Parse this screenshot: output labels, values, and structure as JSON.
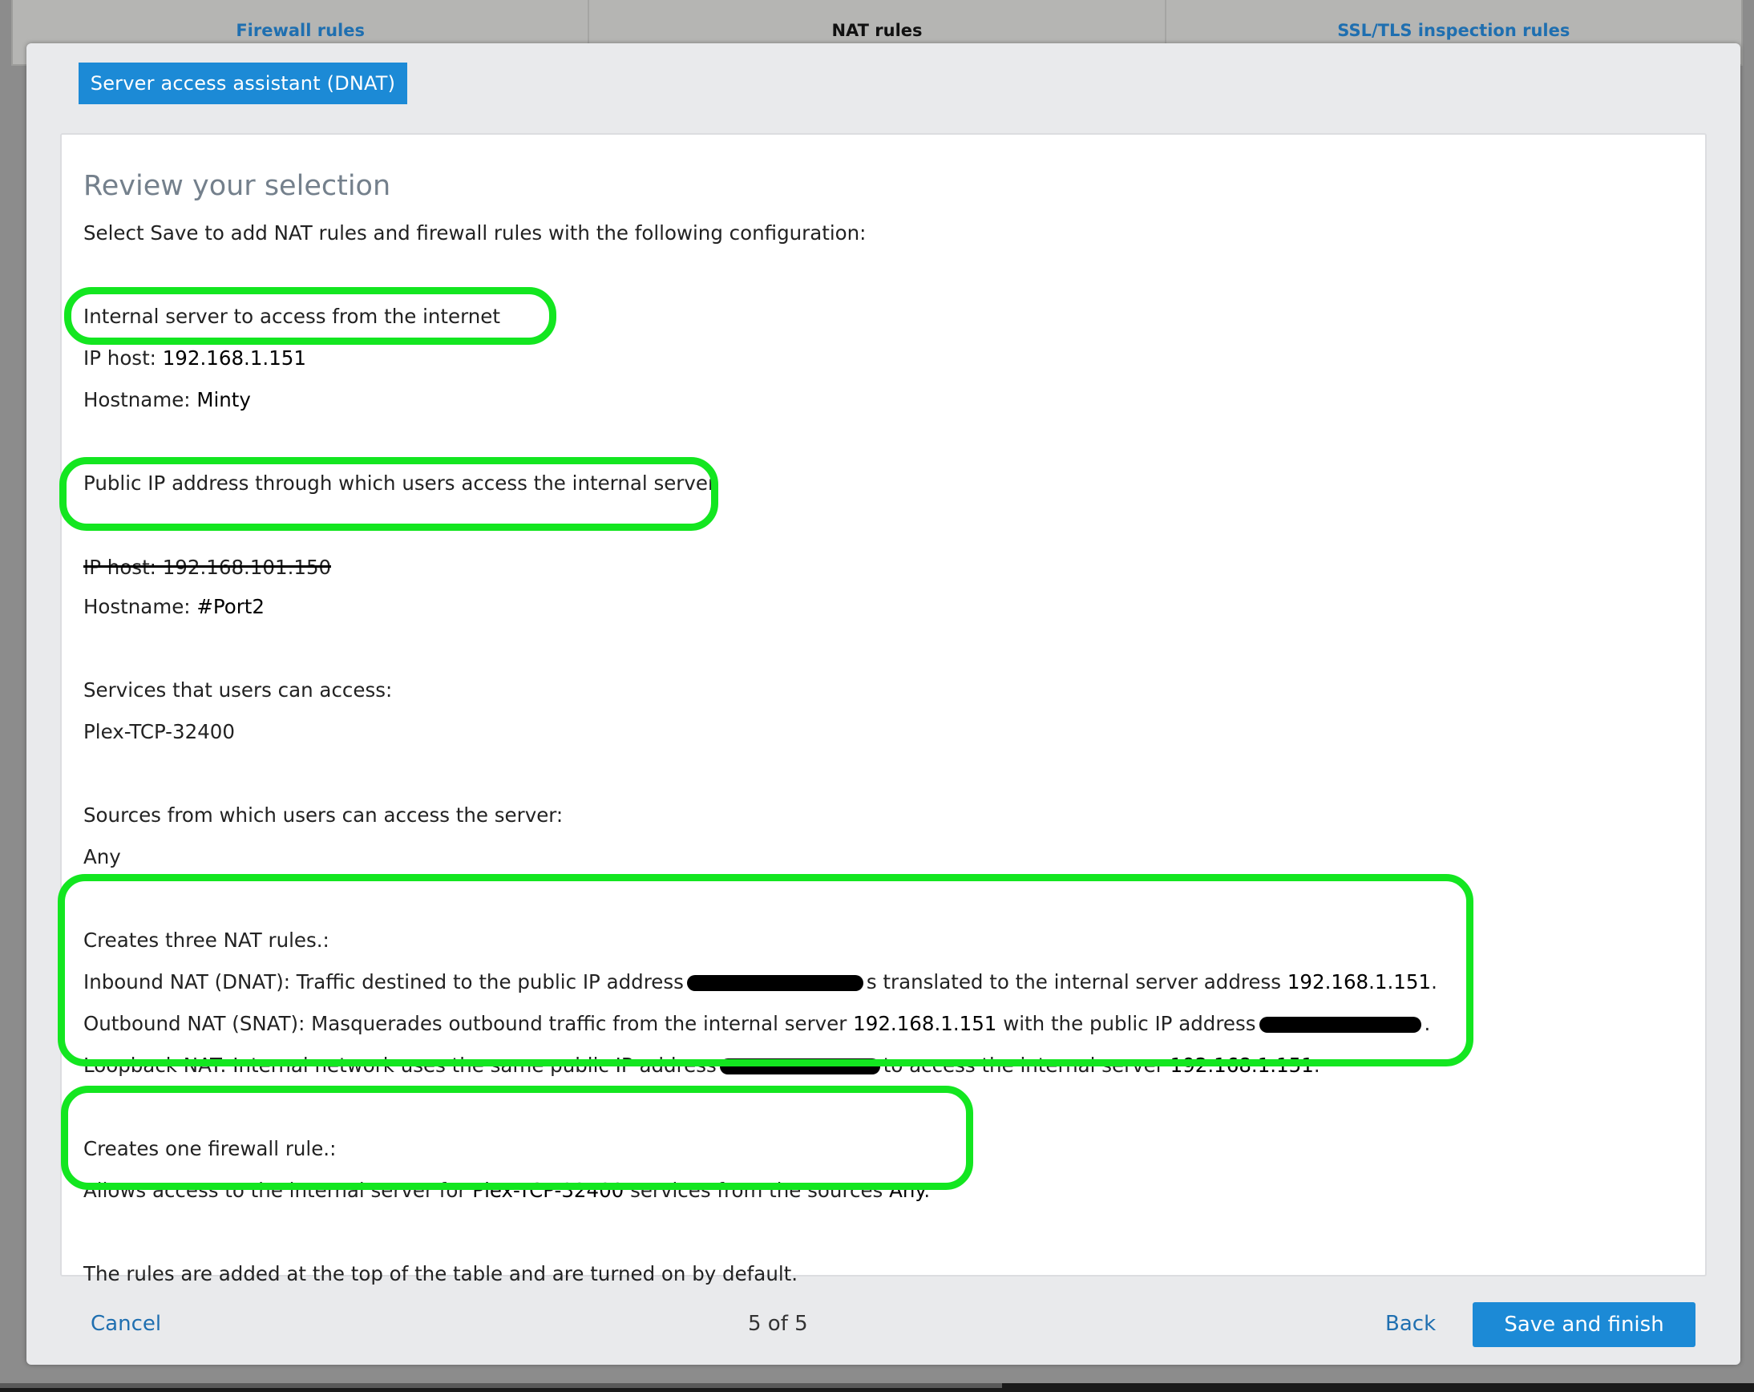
{
  "tabs": [
    {
      "label": "Firewall rules",
      "active": false
    },
    {
      "label": "NAT rules",
      "active": true
    },
    {
      "label": "SSL/TLS inspection rules",
      "active": false
    }
  ],
  "dialog": {
    "title": "Server access assistant (DNAT)",
    "heading": "Review your selection",
    "intro": "Select Save to add NAT rules and firewall rules with the following configuration:",
    "internal": {
      "label": "Internal server to access from the internet",
      "ip_prefix": "IP host: ",
      "ip": "192.168.1.151",
      "hostname_prefix": "Hostname: ",
      "hostname": "Minty"
    },
    "public": {
      "label": "Public IP address through which users access the internal server",
      "ip_line": "IP host: 192.168.101.150",
      "hostname_prefix": "Hostname: ",
      "hostname": "#Port2"
    },
    "services": {
      "label": "Services that users can access:",
      "value": "Plex-TCP-32400"
    },
    "sources": {
      "label": "Sources from which users can access the server:",
      "value": "Any"
    },
    "nat": {
      "label": "Creates three NAT rules.:",
      "inbound_a": "Inbound NAT (DNAT): Traffic destined to the public IP address",
      "inbound_b": "s translated to the internal server address",
      "inbound_ip": "192.168.1.151",
      "outbound_a": "Outbound NAT (SNAT): Masquerades outbound traffic from the internal server",
      "outbound_ip": "192.168.1.151",
      "outbound_b": "with the public IP address",
      "loopback_a": "Loopback NAT: Internal network uses the same public IP address",
      "loopback_b": "to access the internal server",
      "loopback_ip": "192.168.1.151"
    },
    "firewall": {
      "label": "Creates one firewall rule.:",
      "text_a": "Allows access to the internal server for",
      "service": "Plex-TCP-32400",
      "text_b": "services from the sources",
      "source": "Any"
    },
    "note": "The rules are added at the top of the table and are turned on by default."
  },
  "footer": {
    "cancel": "Cancel",
    "pager": "5 of 5",
    "back": "Back",
    "save": "Save and finish"
  },
  "highlight_color": "#13e620",
  "accent_color": "#1c8ad6"
}
